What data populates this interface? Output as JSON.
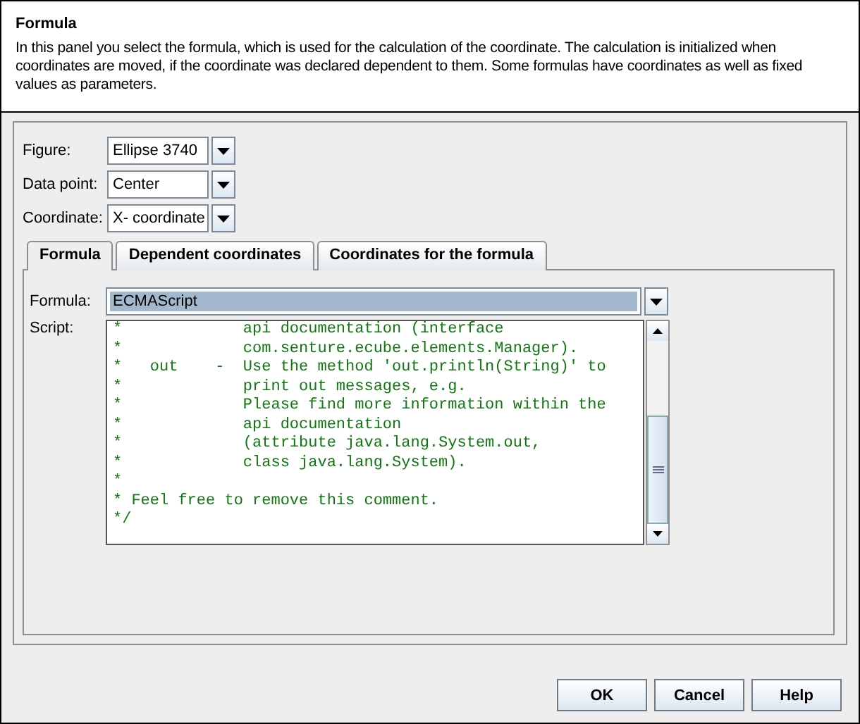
{
  "header": {
    "title": "Formula",
    "description": "In this panel you select the formula, which is used for the calculation of the coordinate. The calculation is initialized when coordinates are moved, if the coordinate was declared dependent to them. Some formulas have coordinates as well as fixed values as parameters."
  },
  "fields": [
    {
      "label": "Figure:",
      "value": "Ellipse 3740"
    },
    {
      "label": "Data point:",
      "value": "Center"
    },
    {
      "label": "Coordinate:",
      "value": "X- coordinate"
    }
  ],
  "tabs": [
    {
      "label": "Formula",
      "selected": true
    },
    {
      "label": "Dependent coordinates",
      "selected": false
    },
    {
      "label": "Coordinates for the formula",
      "selected": false
    }
  ],
  "formula": {
    "label": "Formula:",
    "value": "ECMAScript"
  },
  "script": {
    "label": "Script:",
    "lines": [
      "*             api documentation (interface",
      "*             com.senture.ecube.elements.Manager).",
      "*   out    -  Use the method 'out.println(String)' to",
      "*             print out messages, e.g.",
      "*             Please find more information within the",
      "*             api documentation",
      "*             (attribute java.lang.System.out,",
      "*             class java.lang.System).",
      "*",
      "* Feel free to remove this comment.",
      "*/"
    ]
  },
  "buttons": [
    "OK",
    "Cancel",
    "Help"
  ]
}
